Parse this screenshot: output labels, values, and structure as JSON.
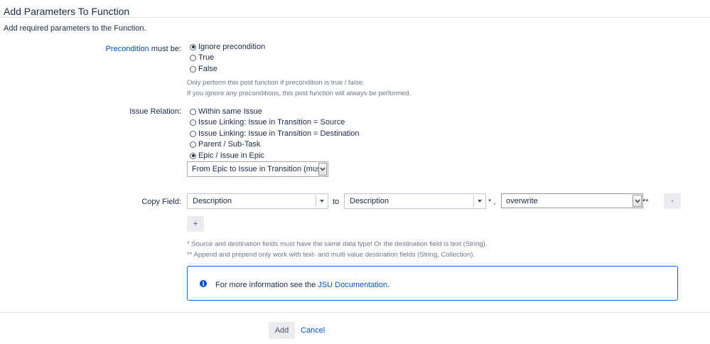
{
  "dialog": {
    "title": "Add Parameters To Function",
    "intro": "Add required parameters to the Function."
  },
  "precondition": {
    "label_link": "Precondition",
    "label_rest": " must be:",
    "options": [
      {
        "label": "Ignore precondition",
        "selected": true
      },
      {
        "label": "True",
        "selected": false
      },
      {
        "label": "False",
        "selected": false
      }
    ],
    "help_line1": "Only perform this post function if precondition is true / false.",
    "help_line2": "If you ignore any preconditions, this post function will always be performed."
  },
  "issue_relation": {
    "label": "Issue Relation:",
    "options": [
      {
        "label": "Within same Issue",
        "selected": false
      },
      {
        "label": "Issue Linking: Issue in Transition = Source",
        "selected": false
      },
      {
        "label": "Issue Linking: Issue in Transition = Destination",
        "selected": false
      },
      {
        "label": "Parent / Sub-Task",
        "selected": false
      },
      {
        "label": "Epic / Issue in Epic",
        "selected": true
      }
    ],
    "direction_value": "From Epic to Issue in Transition (must"
  },
  "copy_field": {
    "label": "Copy Field:",
    "source_value": "Description",
    "to_text": "to",
    "dest_value": "Description",
    "dest_suffix": "* ,",
    "mode_value": "overwrite",
    "mode_suffix": "**",
    "remove_label": "-",
    "add_label": "+",
    "note1": "* Source and destination fields must have the same data type! Or the destination field is text (String).",
    "note2": "** Append and prepend only work with text- and multi value destination fields (String, Collection)."
  },
  "info": {
    "icon": "info-icon",
    "text": "For more information see the ",
    "link": "JSU Documentation",
    "suffix": "."
  },
  "footer": {
    "add_label": "Add",
    "cancel_label": "Cancel"
  },
  "colors": {
    "link": "#0052cc",
    "info_border": "#0065ff",
    "button_bg": "#ebecf0"
  }
}
